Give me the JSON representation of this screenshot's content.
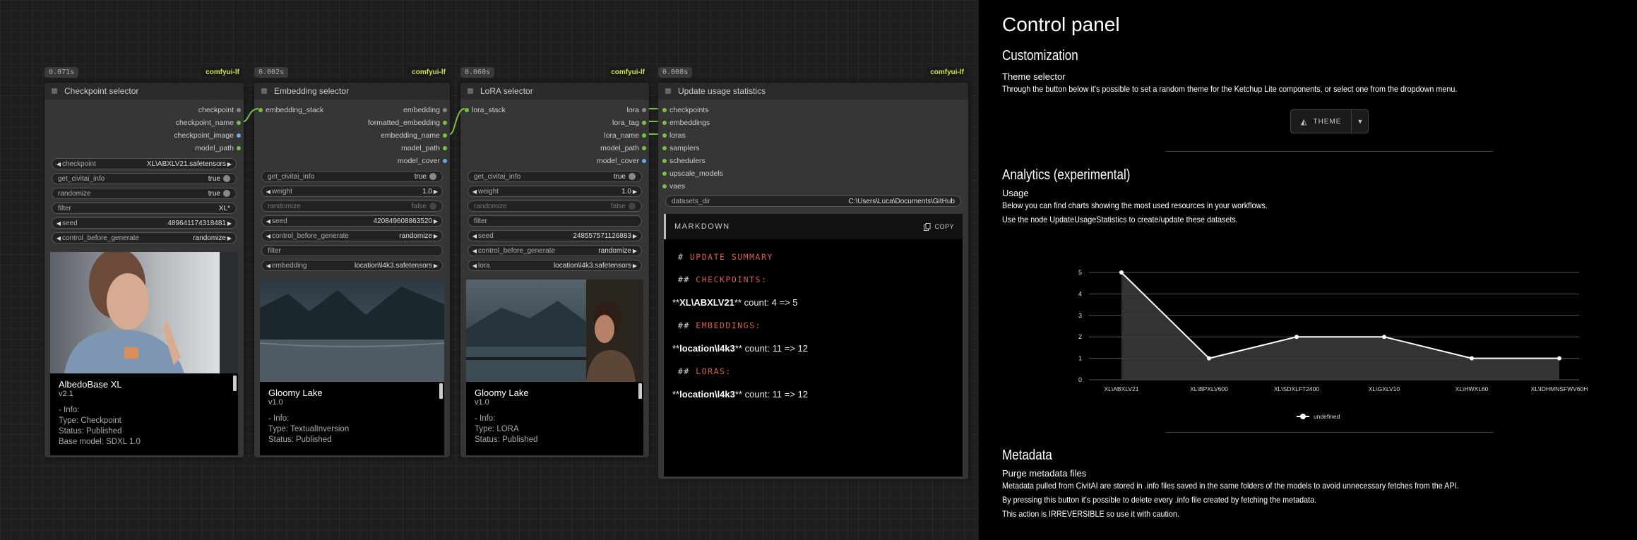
{
  "nodes": {
    "checkpoint": {
      "time": "0.071s",
      "badge": "comfyui-lf",
      "title": "Checkpoint selector",
      "outputs": [
        "checkpoint",
        "checkpoint_name",
        "checkpoint_image",
        "model_path"
      ],
      "widgets": {
        "checkpoint_label": "checkpoint",
        "checkpoint_value": "XL\\ABXLV21.safetensors",
        "civitai_label": "get_civitai_info",
        "civitai_value": "true",
        "randomize_label": "randomize",
        "randomize_value": "true",
        "filter_label": "filter",
        "filter_value": "XL*",
        "seed_label": "seed",
        "seed_value": "489641174318481",
        "control_label": "control_before_generate",
        "control_value": "randomize"
      },
      "card": {
        "name": "AlbedoBase XL",
        "version": "v2.1",
        "lines": [
          "- Info:",
          "Type: Checkpoint",
          "Status: Published",
          "Base model: SDXL 1.0"
        ]
      }
    },
    "embedding": {
      "time": "0.002s",
      "badge": "comfyui-lf",
      "title": "Embedding selector",
      "input": "embedding_stack",
      "outputs": [
        "embedding",
        "formatted_embedding",
        "embedding_name",
        "model_path",
        "model_cover"
      ],
      "widgets": {
        "civitai_label": "get_civitai_info",
        "civitai_value": "true",
        "weight_label": "weight",
        "weight_value": "1.0",
        "randomize_label": "randomize",
        "randomize_value": "false",
        "seed_label": "seed",
        "seed_value": "420849608863520",
        "control_label": "control_before_generate",
        "control_value": "randomize",
        "filter_label": "filter",
        "embedding_label": "embedding",
        "embedding_value": "location\\l4k3.safetensors"
      },
      "card": {
        "name": "Gloomy Lake",
        "version": "v1.0",
        "lines": [
          "- Info:",
          "Type: TextualInversion",
          "Status: Published"
        ]
      }
    },
    "lora": {
      "time": "0.060s",
      "badge": "comfyui-lf",
      "title": "LoRA selector",
      "input": "lora_stack",
      "outputs": [
        "lora",
        "lora_tag",
        "lora_name",
        "model_path",
        "model_cover"
      ],
      "widgets": {
        "civitai_label": "get_civitai_info",
        "civitai_value": "true",
        "weight_label": "weight",
        "weight_value": "1.0",
        "randomize_label": "randomize",
        "randomize_value": "false",
        "filter_label": "filter",
        "seed_label": "seed",
        "seed_value": "248557571126883",
        "control_label": "control_before_generate",
        "control_value": "randomize",
        "lora_label": "lora",
        "lora_value": "location\\l4k3.safetensors"
      },
      "card": {
        "name": "Gloomy Lake",
        "version": "v1.0",
        "lines": [
          "- Info:",
          "Type: LORA",
          "Status: Published"
        ]
      }
    },
    "usage": {
      "time": "0.008s",
      "badge": "comfyui-lf",
      "title": "Update usage statistics",
      "inputs": [
        "checkpoints",
        "embeddings",
        "loras",
        "samplers",
        "schedulers",
        "upscale_models",
        "vaes"
      ],
      "datasets_label": "datasets_dir",
      "datasets_value": "C:\\Users\\Luca\\Documents\\GitHub",
      "markdown_title": "MARKDOWN",
      "copy_label": "COPY",
      "md": {
        "h1_hash": "#",
        "h1_text": "UPDATE SUMMARY",
        "h2a_hash": "##",
        "h2a_text": "CHECKPOINTS:",
        "line1_pre": "**",
        "line1_bold": "XL\\ABXLV21",
        "line1_post": "** count: 4 => 5",
        "h2b_hash": "##",
        "h2b_text": "EMBEDDINGS:",
        "line2_pre": "**",
        "line2_bold": "location\\l4k3",
        "line2_post": "** count: 11 => 12",
        "h2c_hash": "##",
        "h2c_text": "LORAS:",
        "line3_pre": "**",
        "line3_bold": "location\\l4k3",
        "line3_post": "** count: 11 => 12"
      }
    }
  },
  "panel": {
    "title": "Control panel",
    "customization": "Customization",
    "theme_selector": "Theme selector",
    "theme_desc": "Through the button below it's possible to set a random theme for the Ketchup Lite components, or select one from the dropdown menu.",
    "theme_button": "THEME",
    "analytics": "Analytics (experimental)",
    "usage": "Usage",
    "usage_desc1": "Below you can find charts showing the most used resources in your workflows.",
    "usage_desc2": "Use the node UpdateUsageStatistics to create/update these datasets.",
    "metadata": "Metadata",
    "purge": "Purge metadata files",
    "meta1": "Metadata pulled from CivitAI are stored in .info files saved in the same folders of the models to avoid unnecessary fetches from the API.",
    "meta2": "By pressing this button it's possible to delete every .info file created by fetching the metadata.",
    "meta3": "This action is IRREVERSIBLE so use it with caution."
  },
  "chart_data": {
    "type": "area",
    "categories": [
      "XL\\ABXLV21",
      "XL\\BPXLV600",
      "XL\\SDXLFT2400",
      "XL\\GXLV10",
      "XL\\HWXL60",
      "XL\\IDHMNSFWV60H"
    ],
    "values": [
      5,
      1,
      2,
      2,
      1,
      1
    ],
    "yticks": [
      0,
      1,
      2,
      3,
      4,
      5
    ],
    "ylim": [
      0,
      5
    ],
    "legend": "undefined",
    "grid": true,
    "colors": {
      "line": "#ffffff",
      "fill": "#3c3c3c",
      "grid": "#555555"
    }
  }
}
